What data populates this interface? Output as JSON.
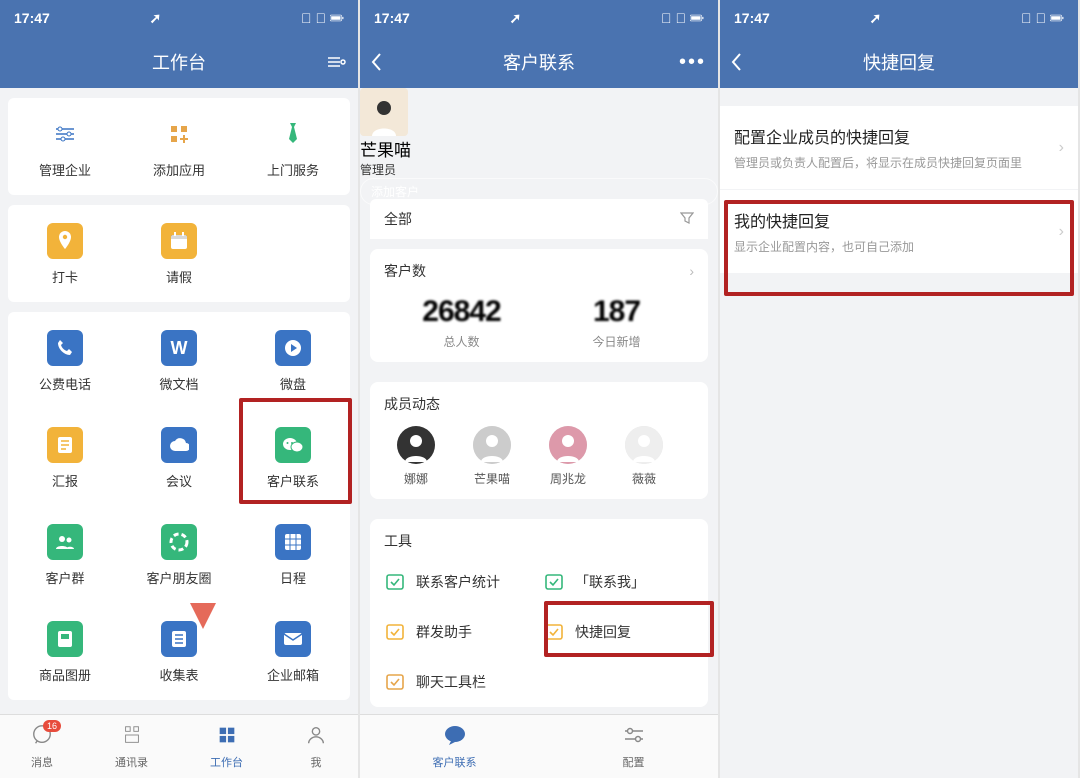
{
  "status": {
    "time": "17:47"
  },
  "screen1": {
    "title": "工作台",
    "groups": [
      [
        {
          "label": "管理企业",
          "icon": "sliders",
          "bg": "#fff",
          "fg": "#3a74c4"
        },
        {
          "label": "添加应用",
          "icon": "plus-grid",
          "bg": "#fff",
          "fg": "#e6a54a"
        },
        {
          "label": "上门服务",
          "icon": "tie",
          "bg": "#fff",
          "fg": "#35b77b"
        }
      ],
      [
        {
          "label": "打卡",
          "icon": "pin",
          "bg": "#f2b33a",
          "fg": "#fff"
        },
        {
          "label": "请假",
          "icon": "calendar",
          "bg": "#f2b33a",
          "fg": "#fff"
        }
      ],
      [
        {
          "label": "公费电话",
          "icon": "phone",
          "bg": "#3a74c4",
          "fg": "#fff"
        },
        {
          "label": "微文档",
          "icon": "w",
          "bg": "#3a74c4",
          "fg": "#fff"
        },
        {
          "label": "微盘",
          "icon": "play",
          "bg": "#3a74c4",
          "fg": "#fff"
        },
        {
          "label": "汇报",
          "icon": "doc",
          "bg": "#f2b33a",
          "fg": "#fff"
        },
        {
          "label": "会议",
          "icon": "cloud",
          "bg": "#3a74c4",
          "fg": "#fff"
        },
        {
          "label": "客户联系",
          "icon": "wechat",
          "bg": "#35b77b",
          "fg": "#fff",
          "highlight": true
        },
        {
          "label": "客户群",
          "icon": "group",
          "bg": "#35b77b",
          "fg": "#fff"
        },
        {
          "label": "客户朋友圈",
          "icon": "circle",
          "bg": "#35b77b",
          "fg": "#fff"
        },
        {
          "label": "日程",
          "icon": "grid",
          "bg": "#3a74c4",
          "fg": "#fff"
        },
        {
          "label": "商品图册",
          "icon": "book",
          "bg": "#35b77b",
          "fg": "#fff"
        },
        {
          "label": "收集表",
          "icon": "sheet",
          "bg": "#3a74c4",
          "fg": "#fff",
          "ribbon": true
        },
        {
          "label": "企业邮箱",
          "icon": "mail",
          "bg": "#3a74c4",
          "fg": "#fff"
        }
      ]
    ],
    "nav": [
      {
        "label": "消息",
        "icon": "chat",
        "badge": "16"
      },
      {
        "label": "通讯录",
        "icon": "contacts"
      },
      {
        "label": "工作台",
        "icon": "grid4",
        "active": true
      },
      {
        "label": "我",
        "icon": "person"
      }
    ]
  },
  "screen2": {
    "title": "客户联系",
    "profile": {
      "name": "芒果喵",
      "role": "管理员",
      "add_btn": "添加客户"
    },
    "filter_all": "全部",
    "stats": {
      "title": "客户数",
      "total_label": "总人数",
      "total_value": "26842",
      "today_label": "今日新增",
      "today_value": "187"
    },
    "members": {
      "title": "成员动态",
      "list": [
        {
          "name": "娜娜"
        },
        {
          "name": "芒果喵"
        },
        {
          "name": "周兆龙"
        },
        {
          "name": "薇薇"
        }
      ]
    },
    "tools": {
      "title": "工具",
      "items": [
        {
          "label": "联系客户统计",
          "color": "#35b77b"
        },
        {
          "label": "「联系我」",
          "color": "#35b77b"
        },
        {
          "label": "群发助手",
          "color": "#f2b33a"
        },
        {
          "label": "快捷回复",
          "color": "#f2b33a",
          "highlight": true
        },
        {
          "label": "聊天工具栏",
          "color": "#e6a54a"
        }
      ]
    },
    "nav": [
      {
        "label": "客户联系",
        "active": true
      },
      {
        "label": "配置"
      }
    ]
  },
  "screen3": {
    "title": "快捷回复",
    "rows": [
      {
        "title": "配置企业成员的快捷回复",
        "desc": "管理员或负责人配置后，将显示在成员快捷回复页面里"
      },
      {
        "title": "我的快捷回复",
        "desc": "显示企业配置内容，也可自己添加",
        "highlight": true
      }
    ]
  }
}
